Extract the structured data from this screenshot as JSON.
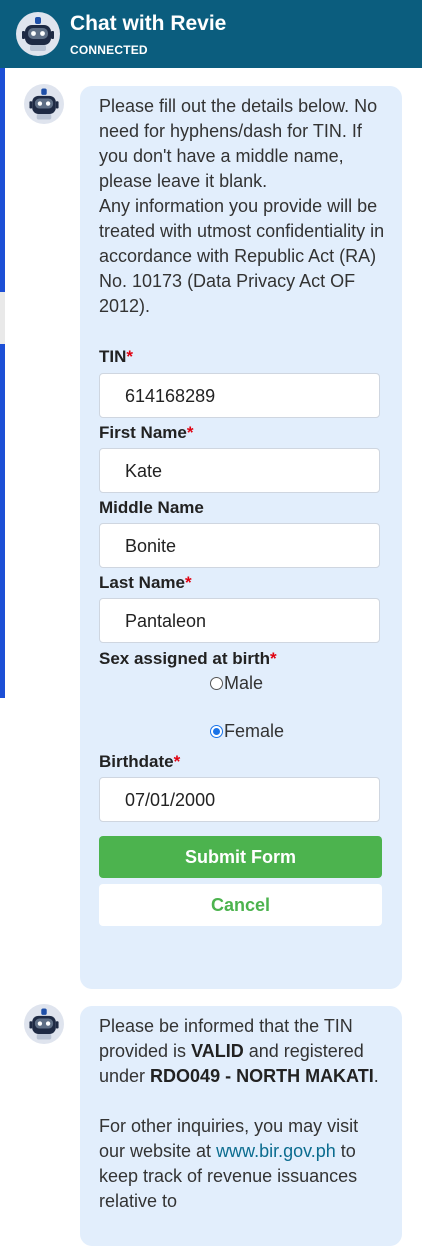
{
  "header": {
    "title": "Chat with Revie",
    "status": "CONNECTED"
  },
  "form_message": {
    "intro": "Please fill out the details below. No need for hyphens/dash for TIN. If you don't have a middle name, please leave it blank.\nAny information you provide will be treated with utmost confidentiality in accordance with Republic Act (RA) No. 10173 (Data Privacy Act OF 2012).",
    "required_mark": "*",
    "tin": {
      "label": "TIN",
      "value": "614168289"
    },
    "first_name": {
      "label": "First Name",
      "value": "Kate"
    },
    "middle_name": {
      "label": "Middle Name",
      "value": "Bonite"
    },
    "last_name": {
      "label": "Last Name",
      "value": "Pantaleon"
    },
    "sex": {
      "label": "Sex assigned at birth",
      "options": [
        {
          "label": "Male",
          "checked": false
        },
        {
          "label": "Female",
          "checked": true
        }
      ]
    },
    "birthdate": {
      "label": "Birthdate",
      "value": "07/01/2000"
    },
    "submit_label": "Submit Form",
    "cancel_label": "Cancel"
  },
  "reply_message": {
    "p1_a": "Please be informed that the TIN provided is ",
    "p1_valid": "VALID",
    "p1_b": " and registered under ",
    "p1_rdo": "RDO049 - NORTH MAKATI",
    "p1_c": ".",
    "p2_a": "For other inquiries, you may visit our website at ",
    "p2_link": "www.bir.gov.ph",
    "p2_b": " to keep track of revenue issuances relative to"
  },
  "colors": {
    "header_bg": "#0b5d7e",
    "bubble_bg": "#e2eefc",
    "submit_bg": "#4cb34e",
    "required": "#e0000f",
    "link": "#0b6c8f"
  }
}
